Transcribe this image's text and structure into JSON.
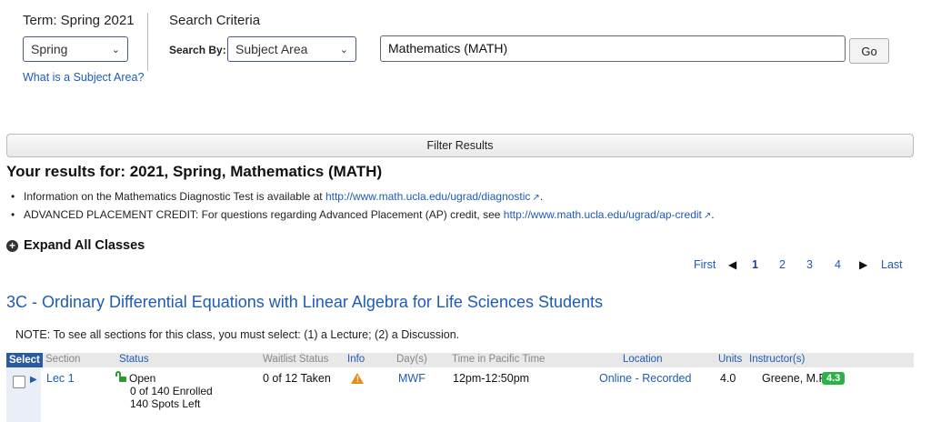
{
  "search": {
    "term_label": "Term: Spring 2021",
    "term_value": "Spring",
    "criteria_label": "Search Criteria",
    "search_by_label": "Search By:",
    "search_by_value": "Subject Area",
    "input_value": "Mathematics (MATH)",
    "go_label": "Go",
    "help_link": "What is a Subject Area?"
  },
  "filter_label": "Filter Results",
  "results": {
    "title": "Your results for: 2021, Spring, Mathematics (MATH)",
    "bullets": [
      {
        "text": "Information on the Mathematics Diagnostic Test is available at ",
        "link": "http://www.math.ucla.edu/ugrad/diagnostic",
        "suffix": "."
      },
      {
        "text": "ADVANCED PLACEMENT CREDIT: For questions regarding Advanced Placement (AP) credit, see ",
        "link": "http://www.math.ucla.edu/ugrad/ap-credit",
        "suffix": "."
      }
    ],
    "expand_label": "Expand All Classes"
  },
  "pagination": {
    "first": "First",
    "pages": [
      "1",
      "2",
      "3",
      "4"
    ],
    "current": "1",
    "last": "Last"
  },
  "class": {
    "title": "3C - Ordinary Differential Equations with Linear Algebra for Life Sciences Students",
    "note": "NOTE: To see all sections for this class, you must select: (1) a Lecture; (2) a Discussion."
  },
  "table": {
    "headers": {
      "select": "Select",
      "section": "Section",
      "status": "Status",
      "waitlist": "Waitlist Status",
      "info": "Info",
      "days": "Day(s)",
      "time": "Time in Pacific Time",
      "location": "Location",
      "units": "Units",
      "instructor": "Instructor(s)"
    },
    "row": {
      "section": "Lec 1",
      "status": "Open",
      "enrolled": "0 of 140 Enrolled",
      "spots": "140 Spots Left",
      "waitlist": "0 of 12 Taken",
      "days": "MWF",
      "time": "12pm-12:50pm",
      "location": "Online - Recorded",
      "units": "4.0",
      "instructor": "Greene, M.P.",
      "rating": "4.3"
    }
  },
  "colors": {
    "link": "#1f5bb8",
    "open": "#2a9a2a",
    "rating": "#2bb34a",
    "warning": "#e98a1c"
  }
}
